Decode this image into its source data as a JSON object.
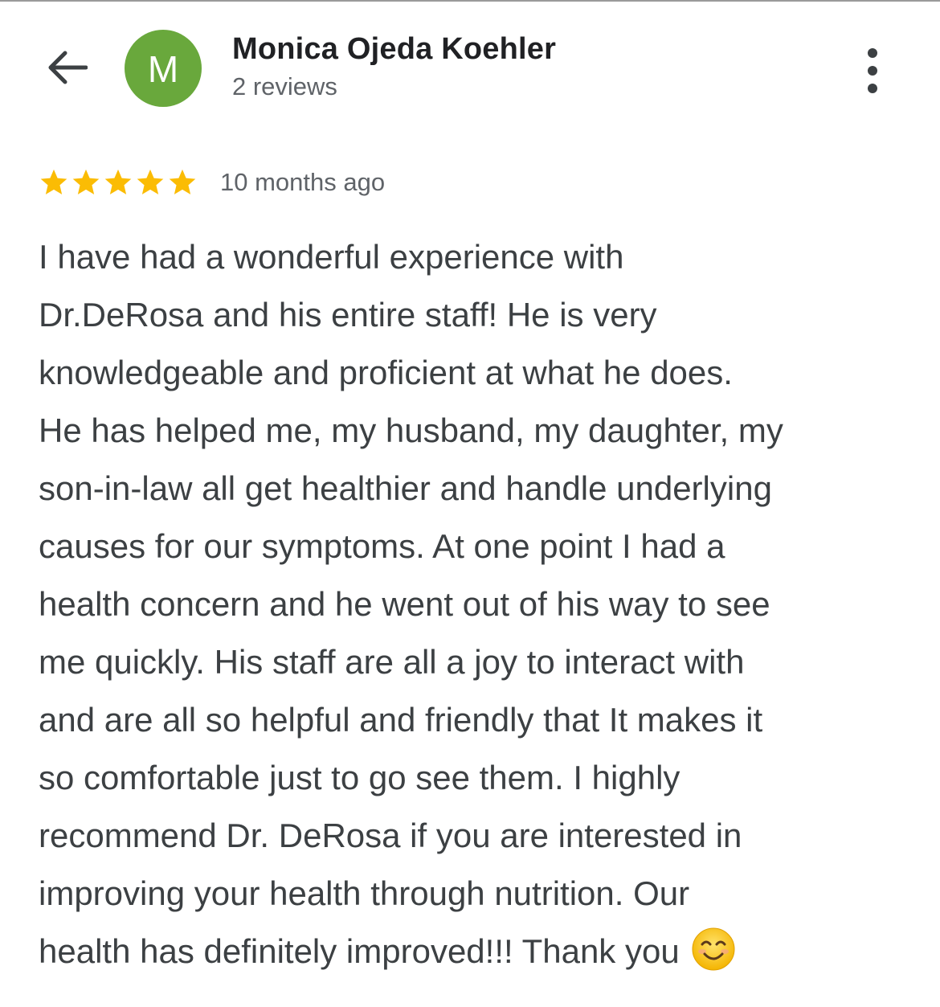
{
  "review": {
    "reviewer": {
      "avatar_initial": "M",
      "avatar_color": "#69a83c",
      "name": "Monica Ojeda Koehler",
      "review_count": "2 reviews"
    },
    "rating": 5,
    "rating_max": 5,
    "star_color": "#fbbc04",
    "time_ago": "10 months ago",
    "text_lines": [
      "I have had a wonderful experience with",
      "Dr.DeRosa and his entire staff! He is very",
      "knowledgeable and proficient at what he does.",
      "He has helped me, my husband, my daughter, my",
      "son-in-law all get healthier and handle underlying",
      "causes for our symptoms. At one point I had a",
      "health concern and he went out of his way to see",
      "me quickly. His staff are all a joy to interact with",
      "and are all so helpful and friendly that It makes it",
      "so comfortable just to go see them. I highly",
      "recommend Dr. DeRosa if you are interested in",
      "improving your health through nutrition. Our",
      "health has definitely improved!!! Thank you"
    ],
    "trailing_emoji": "smiling-face-emoji"
  },
  "icons": {
    "back": "back-arrow-icon",
    "more": "more-vertical-icon",
    "star": "star-icon"
  },
  "colors": {
    "name_text": "#202124",
    "secondary_text": "#5f6368",
    "body_text": "#3c4043"
  }
}
